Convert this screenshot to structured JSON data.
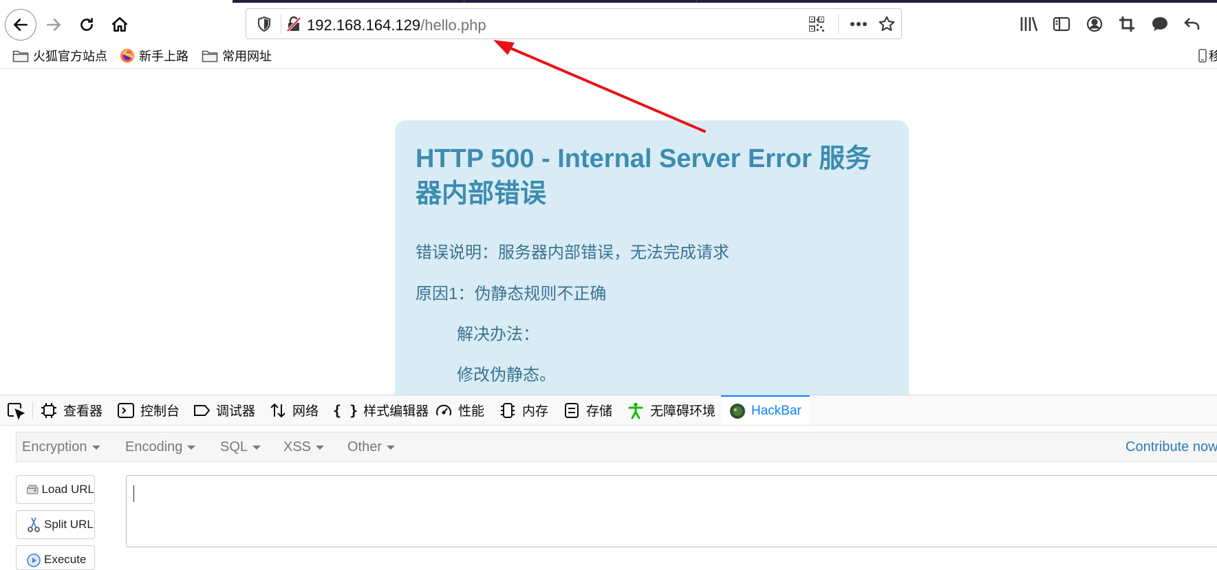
{
  "browser": {
    "url_host": "192.168.164.129",
    "url_path": "/hello.php",
    "bookmarks": [
      {
        "label": "火狐官方站点",
        "icon": "folder-icon"
      },
      {
        "label": "新手上路",
        "icon": "firefox-icon"
      },
      {
        "label": "常用网址",
        "icon": "folder-icon"
      }
    ],
    "bookmarks_overflow_label": "移"
  },
  "page": {
    "error_title": "HTTP 500 - Internal Server Error 服务器内部错误",
    "desc": "错误说明：服务器内部错误，无法完成请求",
    "cause1": "原因1：伪静态规则不正确",
    "solution_label": "解决办法：",
    "solution": "修改伪静态。"
  },
  "devtools": {
    "tabs": [
      {
        "label": "查看器",
        "icon": "inspector-icon"
      },
      {
        "label": "控制台",
        "icon": "console-icon"
      },
      {
        "label": "调试器",
        "icon": "debugger-icon"
      },
      {
        "label": "网络",
        "icon": "network-icon"
      },
      {
        "label": "样式编辑器",
        "icon": "style-editor-icon"
      },
      {
        "label": "性能",
        "icon": "performance-icon"
      },
      {
        "label": "内存",
        "icon": "memory-icon"
      },
      {
        "label": "存储",
        "icon": "storage-icon"
      },
      {
        "label": "无障碍环境",
        "icon": "accessibility-icon"
      },
      {
        "label": "HackBar",
        "icon": "hackbar-icon",
        "active": true
      }
    ]
  },
  "hackbar": {
    "menus": [
      "Encryption",
      "Encoding",
      "SQL",
      "XSS",
      "Other"
    ],
    "contribute": "Contribute now",
    "load_url": "Load URL",
    "split_url": "Split URL",
    "execute": "Execute",
    "textarea_value": ""
  },
  "colors": {
    "error_box_bg": "#d9ecf6",
    "error_title": "#3c8cb0",
    "error_text": "#3b7390",
    "annotation_arrow": "#e8121b",
    "active_tab": "#0a84ff"
  }
}
